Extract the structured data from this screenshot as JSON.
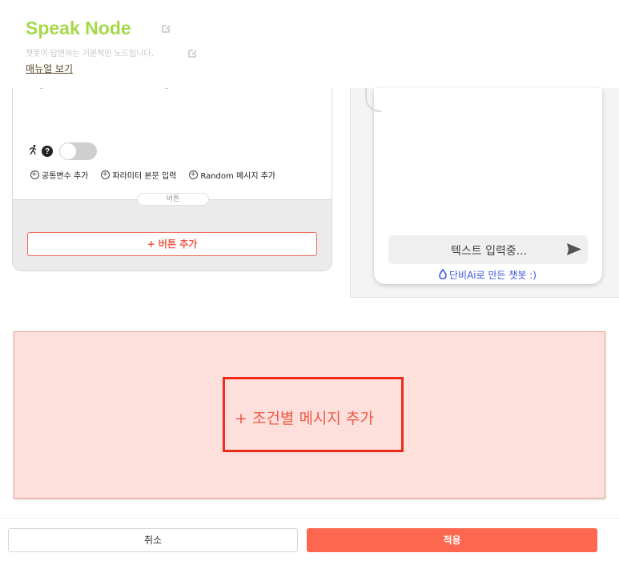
{
  "header": {
    "title": "Speak Node",
    "description": "챗봇이 답변하는 기본적인 노드입니다.",
    "manual_link": "매뉴얼 보기"
  },
  "card": {
    "links": [
      {
        "label": "공통변수 추가"
      },
      {
        "label": "파라미터 본문 입력"
      },
      {
        "label": "Random 메시지 추가"
      }
    ],
    "button_section_label": "버튼",
    "add_button_label": "+ 버튼 추가",
    "toggle_on": false
  },
  "preview": {
    "input_placeholder": "텍스트 입력중...",
    "made_with": "단비Ai로 만든 챗봇 :)"
  },
  "conditional": {
    "add_label": "+ 조건별 메시지 추가"
  },
  "footer": {
    "cancel_label": "취소",
    "apply_label": "적용"
  },
  "colors": {
    "brand_green": "#a6d94a",
    "accent_red": "#fd674f",
    "highlight_border": "#ee2a1b",
    "conditional_bg": "#fde0dc",
    "link_blue": "#3a55e0"
  },
  "icons": [
    "edit-icon",
    "run-icon",
    "help-icon",
    "plus-circle-icon",
    "send-icon",
    "drop-icon"
  ]
}
